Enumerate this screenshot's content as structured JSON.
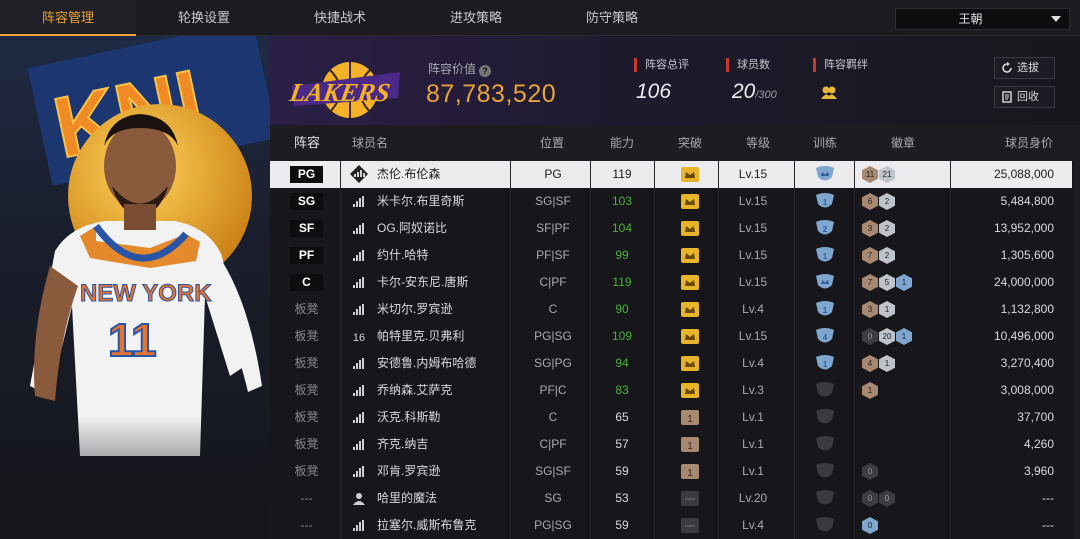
{
  "tabs": [
    "阵容管理",
    "轮换设置",
    "快捷战术",
    "进攻策略",
    "防守策略"
  ],
  "team_select": "王朝",
  "header": {
    "value_label": "阵容价值",
    "value": "87,783,520",
    "stats": [
      {
        "label": "阵容总评",
        "value": "106"
      },
      {
        "label": "球员数",
        "value": "20",
        "suffix": "/300"
      },
      {
        "label": "阵容羁绊"
      }
    ],
    "buttons": [
      "选拔",
      "回收"
    ]
  },
  "columns": [
    "阵容",
    "球员名",
    "位置",
    "能力",
    "突破",
    "等级",
    "训练",
    "徽章",
    "球员身价"
  ],
  "colors": {
    "accent": "#e8a23a",
    "green": "#4caf3d",
    "red_marker": "#c8362e"
  },
  "players": [
    {
      "slot": "PG",
      "tier_icon": "diamond-tier-icon",
      "name": "杰伦.布伦森",
      "pos": "PG",
      "ability": "119",
      "green": false,
      "break": "gold",
      "level": "Lv.15",
      "train": "blue-shield-crown",
      "badges": [
        [
          "br",
          "11"
        ],
        [
          "sv",
          "21"
        ]
      ],
      "worth": "25,088,000"
    },
    {
      "slot": "SG",
      "tier_icon": "bars-tier-icon",
      "name": "米卡尔.布里奇斯",
      "pos": "SG|SF",
      "ability": "103",
      "green": true,
      "break": "gold",
      "level": "Lv.15",
      "train": "blue-shield-1",
      "badges": [
        [
          "br",
          "6"
        ],
        [
          "sv",
          "2"
        ]
      ],
      "worth": "5,484,800"
    },
    {
      "slot": "SF",
      "tier_icon": "bars-tier-icon",
      "name": "OG.阿奴诺比",
      "pos": "SF|PF",
      "ability": "104",
      "green": true,
      "break": "gold",
      "level": "Lv.15",
      "train": "blue-shield-2",
      "badges": [
        [
          "br",
          "3"
        ],
        [
          "sv",
          "2"
        ]
      ],
      "worth": "13,952,000"
    },
    {
      "slot": "PF",
      "tier_icon": "bars-tier-icon",
      "name": "约什.哈特",
      "pos": "PF|SF",
      "ability": "99",
      "green": true,
      "break": "gold",
      "level": "Lv.15",
      "train": "blue-shield-1",
      "badges": [
        [
          "br",
          "7"
        ],
        [
          "sv",
          "2"
        ]
      ],
      "worth": "1,305,600"
    },
    {
      "slot": "C",
      "tier_icon": "bars-tier-icon",
      "name": "卡尔-安东尼.唐斯",
      "pos": "C|PF",
      "ability": "119",
      "green": true,
      "break": "gold",
      "level": "Lv.15",
      "train": "blue-shield-crown",
      "badges": [
        [
          "br",
          "7"
        ],
        [
          "sv",
          "5"
        ],
        [
          "bl",
          "1"
        ]
      ],
      "worth": "24,000,000"
    },
    {
      "slot": "板凳",
      "tier_icon": "bars-tier-icon",
      "name": "米切尔.罗宾逊",
      "pos": "C",
      "ability": "90",
      "green": true,
      "break": "gold",
      "level": "Lv.4",
      "train": "blue-shield-1",
      "badges": [
        [
          "br",
          "3"
        ],
        [
          "sv",
          "1"
        ]
      ],
      "worth": "1,132,800"
    },
    {
      "slot": "板凳",
      "tier_icon": "num-16-tier-icon",
      "name": "帕特里克.贝弗利",
      "pos": "PG|SG",
      "ability": "109",
      "green": true,
      "break": "gold",
      "level": "Lv.15",
      "train": "blue-shield-4",
      "badges": [
        [
          "dk",
          "0"
        ],
        [
          "sv",
          "20"
        ],
        [
          "bl",
          "1"
        ]
      ],
      "worth": "10,496,000"
    },
    {
      "slot": "板凳",
      "tier_icon": "bars-tier-icon",
      "name": "安德鲁.内姆布哈德",
      "pos": "SG|PG",
      "ability": "94",
      "green": true,
      "break": "gold",
      "level": "Lv.4",
      "train": "blue-shield-1",
      "badges": [
        [
          "br",
          "4"
        ],
        [
          "sv",
          "1"
        ]
      ],
      "worth": "3,270,400"
    },
    {
      "slot": "板凳",
      "tier_icon": "bars-tier-icon",
      "name": "乔纳森.艾萨克",
      "pos": "PF|C",
      "ability": "83",
      "green": true,
      "break": "gold",
      "level": "Lv.3",
      "train": "grey-shield",
      "badges": [
        [
          "br",
          "1"
        ]
      ],
      "worth": "3,008,000"
    },
    {
      "slot": "板凳",
      "tier_icon": "bars-tier-icon",
      "name": "沃克.科斯勒",
      "pos": "C",
      "ability": "65",
      "green": false,
      "break": "bronze-1",
      "level": "Lv.1",
      "train": "grey-shield",
      "badges": [],
      "worth": "37,700"
    },
    {
      "slot": "板凳",
      "tier_icon": "bars-tier-icon",
      "name": "齐克.纳吉",
      "pos": "C|PF",
      "ability": "57",
      "green": false,
      "break": "bronze-1",
      "level": "Lv.1",
      "train": "grey-shield",
      "badges": [],
      "worth": "4,260"
    },
    {
      "slot": "板凳",
      "tier_icon": "bars-tier-icon",
      "name": "邓肯.罗宾逊",
      "pos": "SG|SF",
      "ability": "59",
      "green": false,
      "break": "bronze-1",
      "level": "Lv.1",
      "train": "grey-shield",
      "badges": [
        [
          "dk",
          "0"
        ]
      ],
      "worth": "3,960"
    },
    {
      "slot": "---",
      "tier_icon": "person-tier-icon",
      "name": "哈里的魔法",
      "pos": "SG",
      "ability": "53",
      "green": false,
      "break": "grey",
      "level": "Lv.20",
      "train": "grey-shield",
      "badges": [
        [
          "dk",
          "0"
        ],
        [
          "dk",
          "0"
        ]
      ],
      "worth": "---"
    },
    {
      "slot": "---",
      "tier_icon": "bars-tier-icon",
      "name": "拉塞尔.威斯布鲁克",
      "pos": "PG|SG",
      "ability": "59",
      "green": false,
      "break": "grey",
      "level": "Lv.4",
      "train": "grey-shield",
      "badges": [
        [
          "bl",
          "0"
        ]
      ],
      "worth": "---"
    }
  ]
}
